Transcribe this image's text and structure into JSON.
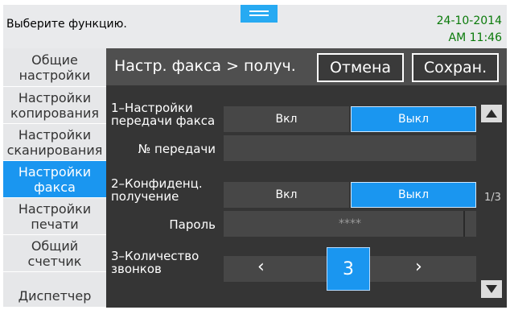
{
  "topbar": {
    "title": "Выберите функцию.",
    "date": "24-10-2014",
    "time": "AM 11:46"
  },
  "sidebar": {
    "items": [
      {
        "line1": "Общие",
        "line2": "настройки"
      },
      {
        "line1": "Настройки",
        "line2": "копирования"
      },
      {
        "line1": "Настройки",
        "line2": "сканирования"
      },
      {
        "line1": "Настройки",
        "line2": "факса"
      },
      {
        "line1": "Настройки",
        "line2": "печати"
      },
      {
        "line1": "Общий",
        "line2": "счетчик"
      },
      {
        "line1": "Диспетчер",
        "line2": ""
      }
    ],
    "active_index": 3
  },
  "header": {
    "path": "Настр. факса > получ.",
    "cancel_label": "Отмена",
    "save_label": "Сохран."
  },
  "settings": {
    "s1": {
      "label_line1": "1–Настройки",
      "label_line2": "передачи факса",
      "on_label": "Вкл",
      "off_label": "Выкл",
      "selected": "off"
    },
    "s1_sub": {
      "label": "№ передачи",
      "value": ""
    },
    "s2": {
      "label_line1": "2–Конфиденц.",
      "label_line2": "получение",
      "on_label": "Вкл",
      "off_label": "Выкл",
      "selected": "off"
    },
    "s2_sub": {
      "label": "Пароль",
      "value": "****"
    },
    "s3": {
      "label_line1": "3–Количество",
      "label_line2": "звонков",
      "value": "3",
      "prev": "‹",
      "next": "›"
    }
  },
  "pager": {
    "indicator": "1/3"
  },
  "colors": {
    "accent": "#1a96f0",
    "time_green": "#0a7a0a"
  },
  "icons": {
    "up": "triangle-up-icon",
    "down": "triangle-down-icon"
  }
}
